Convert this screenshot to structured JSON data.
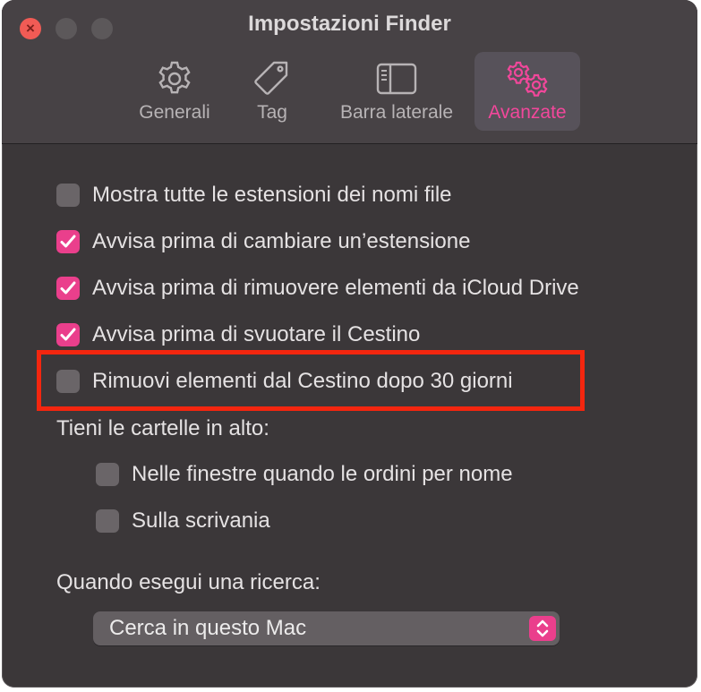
{
  "window": {
    "title": "Impostazioni Finder",
    "close_glyph": "×"
  },
  "tabs": [
    {
      "label": "Generali",
      "icon": "gear-icon",
      "active": false
    },
    {
      "label": "Tag",
      "icon": "tag-icon",
      "active": false
    },
    {
      "label": "Barra laterale",
      "icon": "sidebar-icon",
      "active": false
    },
    {
      "label": "Avanzate",
      "icon": "gears-icon",
      "active": true
    }
  ],
  "options": [
    {
      "label": "Mostra tutte le estensioni dei nomi file",
      "checked": false
    },
    {
      "label": "Avvisa prima di cambiare un’estensione",
      "checked": true
    },
    {
      "label": "Avvisa prima di rimuovere elementi da iCloud Drive",
      "checked": true
    },
    {
      "label": "Avvisa prima di svuotare il Cestino",
      "checked": true
    },
    {
      "label": "Rimuovi elementi dal Cestino dopo 30 giorni",
      "checked": false
    }
  ],
  "folders_section": {
    "label": "Tieni le cartelle in alto:",
    "options": [
      {
        "label": "Nelle finestre quando le ordini per nome",
        "checked": false
      },
      {
        "label": "Sulla scrivania",
        "checked": false
      }
    ]
  },
  "search_section": {
    "label": "Quando esegui una ricerca:",
    "selected": "Cerca in questo Mac"
  },
  "colors": {
    "accent": "#ea3f8c",
    "highlight": "#f3260f",
    "background": "#3b3739"
  }
}
